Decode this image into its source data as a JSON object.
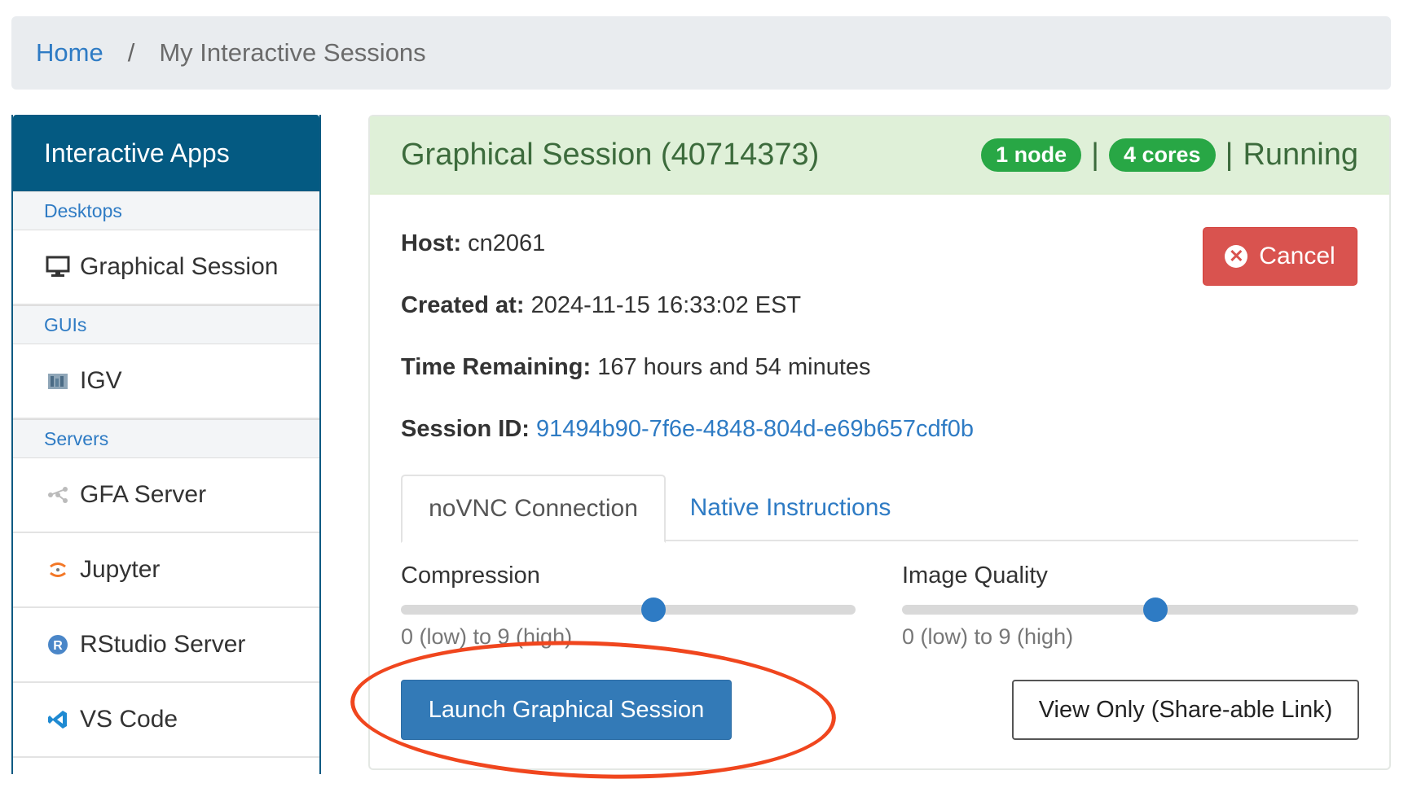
{
  "breadcrumb": {
    "home": "Home",
    "separator": "/",
    "current": "My Interactive Sessions"
  },
  "sidebar": {
    "header": "Interactive Apps",
    "groups": [
      {
        "label": "Desktops",
        "items": [
          {
            "label": "Graphical Session",
            "icon": "monitor-icon"
          }
        ]
      },
      {
        "label": "GUIs",
        "items": [
          {
            "label": "IGV",
            "icon": "igv-icon"
          }
        ]
      },
      {
        "label": "Servers",
        "items": [
          {
            "label": "GFA Server",
            "icon": "gfa-icon"
          },
          {
            "label": "Jupyter",
            "icon": "jupyter-icon"
          },
          {
            "label": "RStudio Server",
            "icon": "rstudio-icon"
          },
          {
            "label": "VS Code",
            "icon": "vscode-icon"
          }
        ]
      }
    ]
  },
  "session": {
    "title": "Graphical Session (40714373)",
    "nodes_badge": "1 node",
    "cores_badge": "4 cores",
    "separator": "|",
    "status": "Running",
    "host_label": "Host:",
    "host_value": "cn2061",
    "created_label": "Created at:",
    "created_value": "2024-11-15 16:33:02 EST",
    "time_label": "Time Remaining:",
    "time_value": "167 hours and 54 minutes",
    "id_label": "Session ID:",
    "id_value": "91494b90-7f6e-4848-804d-e69b657cdf0b",
    "cancel_label": "Cancel"
  },
  "tabs": [
    {
      "label": "noVNC Connection",
      "active": true
    },
    {
      "label": "Native Instructions",
      "active": false
    }
  ],
  "sliders": {
    "compression": {
      "label": "Compression",
      "hint": "0 (low) to 9 (high)",
      "min": 0,
      "max": 9,
      "value": 5
    },
    "quality": {
      "label": "Image Quality",
      "hint": "0 (low) to 9 (high)",
      "min": 0,
      "max": 9,
      "value": 5
    }
  },
  "buttons": {
    "launch": "Launch Graphical Session",
    "view_only": "View Only (Share-able Link)"
  },
  "colors": {
    "primary": "#337ab7",
    "danger": "#d9534f",
    "success_badge": "#28a745",
    "sidebar_header": "#045a82",
    "annotation": "#f0461e"
  }
}
